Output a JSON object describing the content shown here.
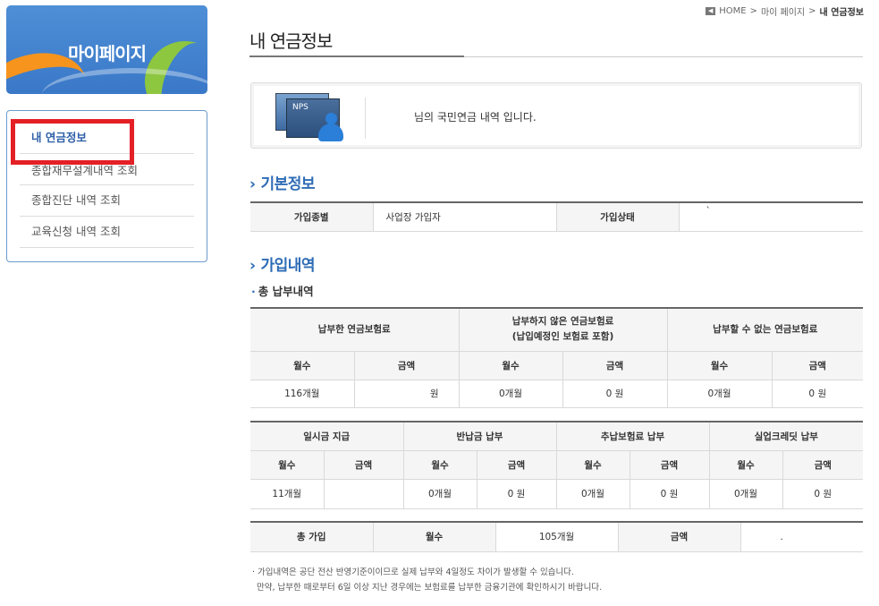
{
  "banner": {
    "title": "마이페이지"
  },
  "menu": {
    "items": [
      {
        "label": "내 연금정보"
      },
      {
        "label": "종합재무설계내역 조회"
      },
      {
        "label": "종합진단 내역 조회"
      },
      {
        "label": "교육신청 내역 조회"
      }
    ]
  },
  "breadcrumb": {
    "home": "HOME",
    "sep1": ">",
    "mypage": "마이 페이지",
    "sep2": ">",
    "current": "내 연금정보"
  },
  "page": {
    "title": "내 연금정보"
  },
  "info": {
    "icon_text": "NPS",
    "message": "님의 국민연금 내역 입니다."
  },
  "basic": {
    "heading": "기본정보",
    "type_label": "가입종별",
    "type_value": "사업장 가입자",
    "status_label": "가입상태",
    "status_value": "`"
  },
  "history": {
    "heading": "가입내역",
    "sub_heading": "총 납부내역",
    "paid": {
      "header": "납부한 연금보험료",
      "months": "116개월",
      "amount": "원"
    },
    "unpaid": {
      "header": "납부하지 않은 연금보험료",
      "header2": "(납입예정인 보험료 포함)",
      "months": "0개월",
      "amount": "0 원"
    },
    "cannot": {
      "header": "납부할 수 없는 연금보험료",
      "months": "0개월",
      "amount": "0 원"
    },
    "col_months": "월수",
    "col_amount": "금액",
    "lump": {
      "header": "일시금 지급",
      "months": "11개월",
      "amount": ""
    },
    "refund": {
      "header": "반납금 납부",
      "months": "0개월",
      "amount": "0 원"
    },
    "late": {
      "header": "추납보험료 납부",
      "months": "0개월",
      "amount": "0 원"
    },
    "unemployment": {
      "header": "실업크레딧 납부",
      "months": "0개월",
      "amount": "0 원"
    },
    "total": {
      "label": "총 가입",
      "months_label": "월수",
      "months": "105개월",
      "amount_label": "금액",
      "amount": "."
    }
  },
  "notes": {
    "line1": "· 가입내역은 공단 전산 반영기준이이므로 실제 납부와 4일정도 차이가 발생할 수 있습니다.",
    "line2": "만약, 납부한 때로부터 6일 이상 지난 경우에는 보험료를 납부한 금융기관에 확인하시기 바랍니다."
  }
}
